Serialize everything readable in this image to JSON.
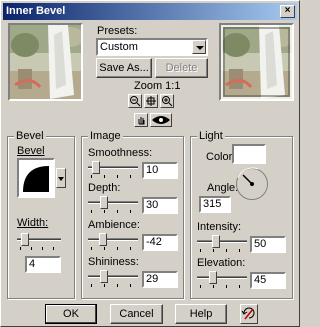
{
  "window": {
    "title": "Inner Bevel",
    "close_glyph": "×"
  },
  "presets": {
    "label": "Presets:",
    "label_mnemonic": "P",
    "value": "Custom",
    "save_as_label": "Save As...",
    "delete_label": "Delete"
  },
  "zoom": {
    "label": "Zoom 1:1",
    "buttons": [
      "zoom-out-icon",
      "zoom-fit-icon",
      "zoom-in-icon"
    ],
    "proof_icon": "hand-icon",
    "preview_icon": "eye-icon"
  },
  "bevel": {
    "group_title": "Bevel",
    "bevel_label": "Bevel",
    "width_label": "Width:",
    "width_value": "4"
  },
  "image": {
    "group_title": "Image",
    "smoothness": {
      "label": "Smoothness:",
      "value": "10"
    },
    "depth": {
      "label": "Depth:",
      "value": "30"
    },
    "ambience": {
      "label": "Ambience:",
      "value": "-42"
    },
    "shininess": {
      "label": "Shininess:",
      "value": "29"
    }
  },
  "light": {
    "group_title": "Light",
    "color_label": "Color:",
    "color_value": "#ffffff",
    "angle_label": "Angle:",
    "angle_value": "315",
    "intensity": {
      "label": "Intensity:",
      "value": "50"
    },
    "elevation": {
      "label": "Elevation:",
      "value": "45"
    }
  },
  "footer": {
    "ok_label": "OK",
    "cancel_label": "Cancel",
    "help_label": "Help",
    "reset_icon": "reset-icon"
  },
  "colors": {
    "titlebar_start": "#0a246a",
    "titlebar_end": "#a6caf0",
    "face": "#d4d0c8"
  }
}
